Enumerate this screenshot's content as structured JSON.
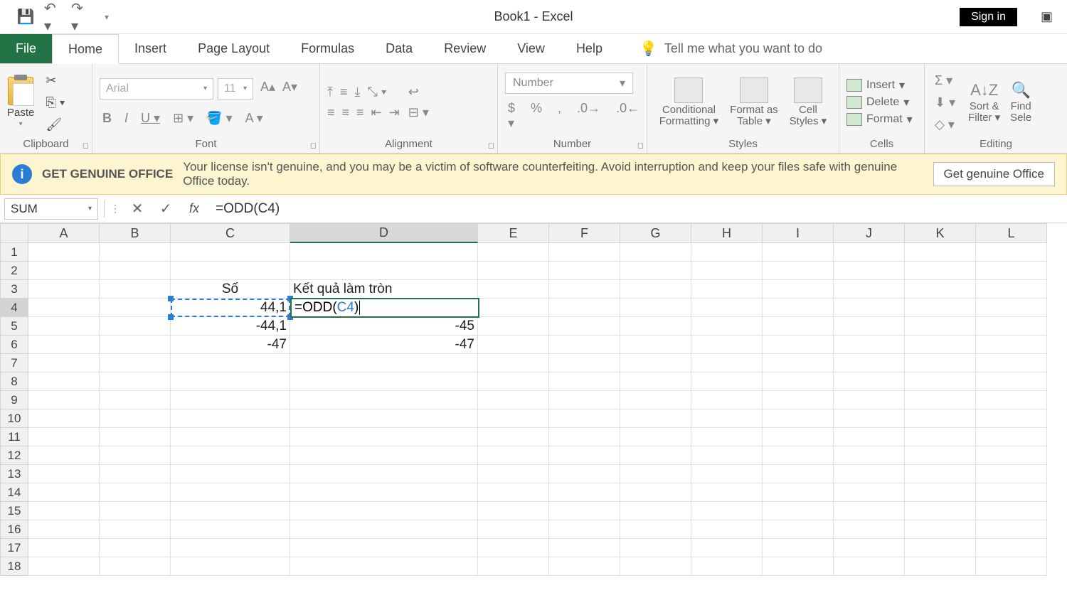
{
  "title": "Book1  -  Excel",
  "signin": "Sign in",
  "tabs": {
    "file": "File",
    "home": "Home",
    "insert": "Insert",
    "pagelayout": "Page Layout",
    "formulas": "Formulas",
    "data": "Data",
    "review": "Review",
    "view": "View",
    "help": "Help",
    "tellme": "Tell me what you want to do"
  },
  "ribbon": {
    "clipboard": {
      "paste": "Paste",
      "label": "Clipboard"
    },
    "font": {
      "name": "Arial",
      "size": "11",
      "label": "Font"
    },
    "alignment": {
      "label": "Alignment"
    },
    "number": {
      "format": "Number",
      "label": "Number"
    },
    "styles": {
      "cond": "Conditional Formatting",
      "fmtas": "Format as Table",
      "cell": "Cell Styles",
      "label": "Styles"
    },
    "cells": {
      "insert": "Insert",
      "delete": "Delete",
      "format": "Format",
      "label": "Cells"
    },
    "editing": {
      "sortfilter": "Sort & Filter",
      "find": "Find Sele",
      "label": "Editing"
    }
  },
  "warning": {
    "title": "GET GENUINE OFFICE",
    "text": "Your license isn't genuine, and you may be a victim of software counterfeiting. Avoid interruption and keep your files safe with genuine Office today.",
    "button": "Get genuine Office"
  },
  "formulabar": {
    "namebox": "SUM",
    "formula": "=ODD(C4)"
  },
  "columns": [
    "A",
    "B",
    "C",
    "D",
    "E",
    "F",
    "G",
    "H",
    "I",
    "J",
    "K",
    "L"
  ],
  "rows": [
    "1",
    "2",
    "3",
    "4",
    "5",
    "6",
    "7",
    "8",
    "9",
    "10",
    "11",
    "12",
    "13",
    "14",
    "15",
    "16",
    "17",
    "18"
  ],
  "cells": {
    "C3": "Số",
    "D3": "Kết quả làm tròn",
    "C4": "44,1",
    "D4_prefix": "=ODD(",
    "D4_ref": "C4",
    "D4_suffix": ")",
    "C5": "-44,1",
    "D5": "-45",
    "C6": "-47",
    "D6": "-47"
  }
}
